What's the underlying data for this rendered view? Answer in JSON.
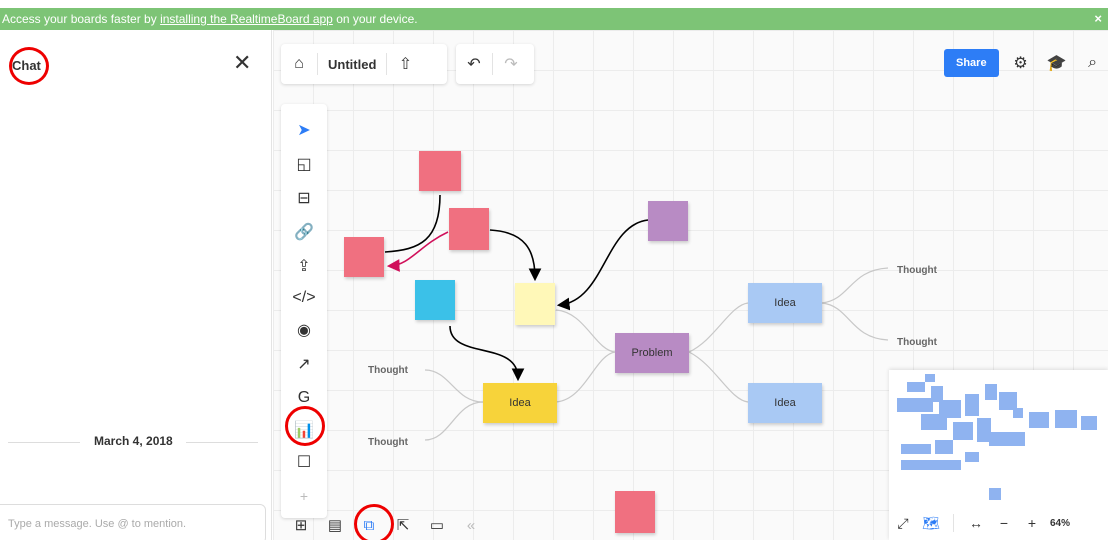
{
  "banner": {
    "text_before": "Access your boards faster by ",
    "link_text": "installing the RealtimeBoard app",
    "text_after": " on your device.",
    "close": "×"
  },
  "chat": {
    "title": "Chat",
    "close": "✕",
    "date": "March 4, 2018",
    "input_placeholder": "Type a message. Use @ to mention."
  },
  "topbar": {
    "board_title": "Untitled",
    "home": "⌂",
    "upload": "⇧",
    "undo": "↶",
    "redo": "↷"
  },
  "rightbar": {
    "share_label": "Share",
    "settings": "⚙",
    "learn": "🎓",
    "search": "⌕"
  },
  "tools": [
    {
      "name": "select-tool",
      "glyph": "➤"
    },
    {
      "name": "sticky-note-tool",
      "glyph": "◱"
    },
    {
      "name": "templates-tool",
      "glyph": "⊟"
    },
    {
      "name": "link-tool",
      "glyph": "🔗"
    },
    {
      "name": "upload-tool",
      "glyph": "⇪"
    },
    {
      "name": "embed-tool",
      "glyph": "</>"
    },
    {
      "name": "view-tool",
      "glyph": "◉"
    },
    {
      "name": "arrow-tool",
      "glyph": "↗"
    },
    {
      "name": "google-drive-tool",
      "glyph": "G"
    },
    {
      "name": "chart-tool",
      "glyph": "📊"
    },
    {
      "name": "frame-tool",
      "glyph": "☐"
    },
    {
      "name": "add-tool",
      "glyph": "+"
    }
  ],
  "bottombar": [
    {
      "name": "board-list-icon",
      "glyph": "⊞"
    },
    {
      "name": "comments-icon",
      "glyph": "▤"
    },
    {
      "name": "chat-toggle-icon",
      "glyph": "⧉"
    },
    {
      "name": "share-screen-icon",
      "glyph": "⇱"
    },
    {
      "name": "video-call-icon",
      "glyph": "▭"
    },
    {
      "name": "collapse-icon",
      "glyph": "«"
    }
  ],
  "canvas": {
    "notes": [
      {
        "name": "sticky-note-pink-1",
        "color": "#f07080",
        "label": ""
      },
      {
        "name": "sticky-note-pink-2",
        "color": "#f07080",
        "label": ""
      },
      {
        "name": "sticky-note-pink-3",
        "color": "#f07080",
        "label": ""
      },
      {
        "name": "sticky-note-purple-1",
        "color": "#b88bc4",
        "label": ""
      },
      {
        "name": "sticky-note-cyan-1",
        "color": "#3bc1e8",
        "label": ""
      },
      {
        "name": "sticky-note-yellow-1",
        "color": "#fff8b8",
        "label": ""
      },
      {
        "name": "sticky-note-pink-4",
        "color": "#f07080",
        "label": ""
      },
      {
        "name": "problem-node",
        "color": "#b88bc4",
        "label": "Problem"
      },
      {
        "name": "idea-node-1",
        "color": "#a9c9f4",
        "label": "Idea"
      },
      {
        "name": "idea-node-2",
        "color": "#a9c9f4",
        "label": "Idea"
      },
      {
        "name": "idea-node-3",
        "color": "#f7d33a",
        "label": "Idea"
      }
    ],
    "thoughts": [
      "Thought",
      "Thought",
      "Thought",
      "Thought"
    ]
  },
  "minimap": {
    "fit": "⤢",
    "map": "🗺",
    "fit_width": "↔",
    "zoom_out": "−",
    "zoom_in": "+",
    "zoom": "64%"
  },
  "colors": {
    "banner": "#7dc476",
    "accent": "#2d7df6",
    "annotation": "#e00000"
  }
}
